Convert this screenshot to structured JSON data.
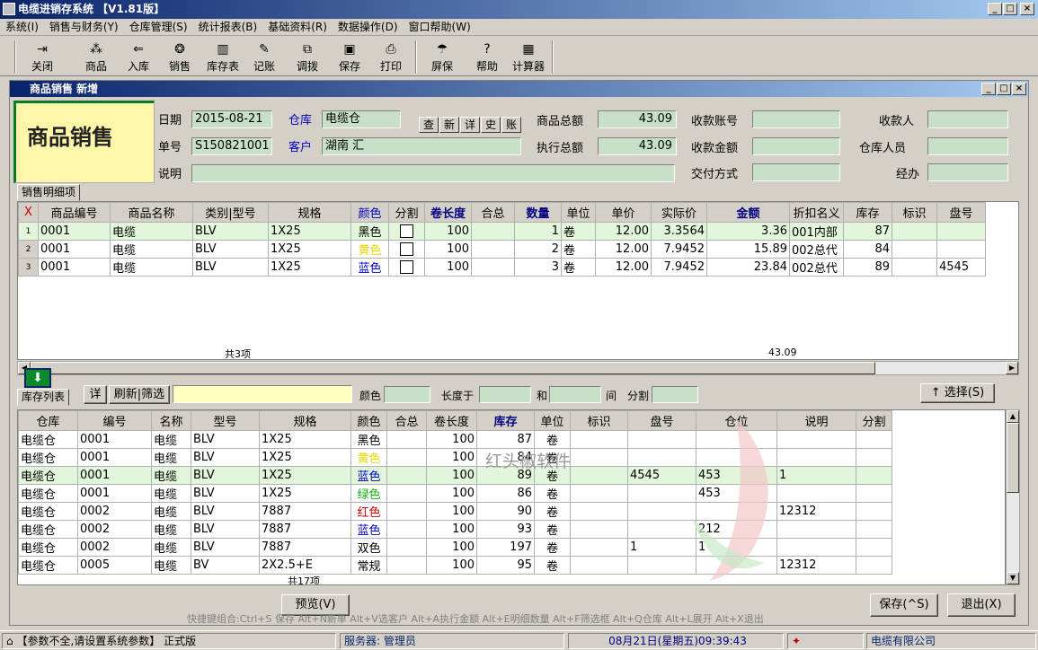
{
  "app": {
    "title": "电缆进销存系统 【V1.81版】"
  },
  "menu": [
    "系统(I)",
    "销售与财务(Y)",
    "仓库管理(S)",
    "统计报表(B)",
    "基础资料(R)",
    "数据操作(D)",
    "窗口帮助(W)"
  ],
  "toolbar": [
    {
      "label": "关闭",
      "icon": "exit-icon",
      "glyph": "⇥"
    },
    {
      "label": "商品",
      "icon": "goods-icon",
      "glyph": "⁂"
    },
    {
      "label": "入库",
      "icon": "stock-in-icon",
      "glyph": "⇐"
    },
    {
      "label": "销售",
      "icon": "sales-icon",
      "glyph": "❂"
    },
    {
      "label": "库存表",
      "icon": "inventory-chart-icon",
      "glyph": "▥"
    },
    {
      "label": "记账",
      "icon": "bookkeeping-icon",
      "glyph": "✎"
    },
    {
      "label": "调拨",
      "icon": "transfer-icon",
      "glyph": "⧉"
    },
    {
      "label": "保存",
      "icon": "save-icon",
      "glyph": "▣"
    },
    {
      "label": "打印",
      "icon": "print-icon",
      "glyph": "⎙"
    },
    {
      "label": "屏保",
      "icon": "screensaver-icon",
      "glyph": "☂"
    },
    {
      "label": "帮助",
      "icon": "help-icon",
      "glyph": "?"
    },
    {
      "label": "计算器",
      "icon": "calculator-icon",
      "glyph": "▦"
    }
  ],
  "form": {
    "window_title": "商品销售 新增",
    "logo_text": "商品销售",
    "date_label": "日期",
    "date_value": "2015-08-21",
    "warehouse_label": "仓库",
    "warehouse_value": "电缆仓",
    "order_label": "单号",
    "order_value": "S150821001",
    "customer_label": "客户",
    "customer_value": "湖南          汇",
    "note_label": "说明",
    "note_value": "",
    "mini_buttons": [
      "查",
      "新",
      "详",
      "史",
      "账"
    ],
    "goods_total_label": "商品总额",
    "goods_total_value": "43.09",
    "exec_total_label": "执行总额",
    "exec_total_value": "43.09",
    "account_label": "收款账号",
    "account_value": "",
    "amount_label": "收款金额",
    "amount_value": "",
    "pay_label": "交付方式",
    "pay_value": "",
    "receiver_label": "收款人",
    "receiver_value": "",
    "warehouse_staff_label": "仓库人员",
    "warehouse_staff_value": "",
    "handler_label": "经办",
    "handler_value": ""
  },
  "detail": {
    "tab": "销售明细项",
    "headers": [
      "X",
      "商品编号",
      "商品名称",
      "类别|型号",
      "规格",
      "颜色",
      "分割",
      "卷长度",
      "合总",
      "数量",
      "单位",
      "单价",
      "实际价",
      "金额",
      "折扣名义",
      "库存",
      "标识",
      "盘号"
    ],
    "rows": [
      {
        "n": "1",
        "code": "0001",
        "name": "电缆",
        "model": "BLV",
        "spec": "1X25",
        "color": "黑色",
        "colorHex": "#000000",
        "len": "100",
        "total": "",
        "qty": "1",
        "unit": "卷",
        "price": "12.00",
        "real": "3.3564",
        "amount": "3.36",
        "disc": "001内部",
        "stock": "87",
        "mark": "",
        "reel": ""
      },
      {
        "n": "2",
        "code": "0001",
        "name": "电缆",
        "model": "BLV",
        "spec": "1X25",
        "color": "黄色",
        "colorHex": "#e8d800",
        "len": "100",
        "total": "",
        "qty": "2",
        "unit": "卷",
        "price": "12.00",
        "real": "7.9452",
        "amount": "15.89",
        "disc": "002总代",
        "stock": "84",
        "mark": "",
        "reel": ""
      },
      {
        "n": "3",
        "code": "0001",
        "name": "电缆",
        "model": "BLV",
        "spec": "1X25",
        "color": "蓝色",
        "colorHex": "#0000c0",
        "len": "100",
        "total": "",
        "qty": "3",
        "unit": "卷",
        "price": "12.00",
        "real": "7.9452",
        "amount": "23.84",
        "disc": "002总代",
        "stock": "89",
        "mark": "",
        "reel": "4545"
      }
    ],
    "footer_count": "共3项",
    "footer_total": "43.09"
  },
  "stock": {
    "tab": "库存列表",
    "btn_detail": "详",
    "btn_refresh": "刷新|筛选",
    "color_label": "颜色",
    "length_label": "长度于",
    "and_label": "和",
    "between_label": "间",
    "split_label": "分割",
    "select_button": "↑ 选择(S)",
    "headers": [
      "仓库",
      "编号",
      "名称",
      "型号",
      "规格",
      "颜色",
      "合总",
      "卷长度",
      "库存",
      "单位",
      "标识",
      "盘号",
      "仓位",
      "说明",
      "分割"
    ],
    "rows": [
      {
        "wh": "电缆仓",
        "code": "0001",
        "name": "电缆",
        "model": "BLV",
        "spec": "1X25",
        "color": "黑色",
        "colorHex": "#000000",
        "total": "",
        "len": "100",
        "stock": "87",
        "unit": "卷",
        "mark": "",
        "reel": "",
        "loc": "",
        "note": ""
      },
      {
        "wh": "电缆仓",
        "code": "0001",
        "name": "电缆",
        "model": "BLV",
        "spec": "1X25",
        "color": "黄色",
        "colorHex": "#e8d800",
        "total": "",
        "len": "100",
        "stock": "84",
        "unit": "卷",
        "mark": "",
        "reel": "",
        "loc": "",
        "note": ""
      },
      {
        "wh": "电缆仓",
        "code": "0001",
        "name": "电缆",
        "model": "BLV",
        "spec": "1X25",
        "color": "蓝色",
        "colorHex": "#0000c0",
        "total": "",
        "len": "100",
        "stock": "89",
        "unit": "卷",
        "mark": "",
        "reel": "4545",
        "loc": "453",
        "note": "1"
      },
      {
        "wh": "电缆仓",
        "code": "0001",
        "name": "电缆",
        "model": "BLV",
        "spec": "1X25",
        "color": "绿色",
        "colorHex": "#10b010",
        "total": "",
        "len": "100",
        "stock": "86",
        "unit": "卷",
        "mark": "",
        "reel": "",
        "loc": "453",
        "note": ""
      },
      {
        "wh": "电缆仓",
        "code": "0002",
        "name": "电缆",
        "model": "BLV",
        "spec": "7887",
        "color": "红色",
        "colorHex": "#d00000",
        "total": "",
        "len": "100",
        "stock": "90",
        "unit": "卷",
        "mark": "",
        "reel": "",
        "loc": "",
        "note": "12312"
      },
      {
        "wh": "电缆仓",
        "code": "0002",
        "name": "电缆",
        "model": "BLV",
        "spec": "7887",
        "color": "蓝色",
        "colorHex": "#0000c0",
        "total": "",
        "len": "100",
        "stock": "93",
        "unit": "卷",
        "mark": "",
        "reel": "",
        "loc": "212",
        "note": ""
      },
      {
        "wh": "电缆仓",
        "code": "0002",
        "name": "电缆",
        "model": "BLV",
        "spec": "7887",
        "color": "双色",
        "colorHex": "#000000",
        "total": "",
        "len": "100",
        "stock": "197",
        "unit": "卷",
        "mark": "",
        "reel": "1",
        "loc": "1",
        "note": ""
      },
      {
        "wh": "电缆仓",
        "code": "0005",
        "name": "电缆",
        "model": "BV",
        "spec": "2X2.5+E",
        "color": "常规",
        "colorHex": "#000000",
        "total": "",
        "len": "100",
        "stock": "95",
        "unit": "卷",
        "mark": "",
        "reel": "",
        "loc": "",
        "note": "12312"
      }
    ],
    "footer_count": "共17项",
    "watermark": "红头椒软件"
  },
  "actions": {
    "preview": "预览(V)",
    "save": "保存(^S)",
    "exit": "退出(X)"
  },
  "hint": "快捷键组合:Ctrl+S 保存 Alt+N新单 Alt+V选客户 Alt+A执行金额 Alt+E明细数量 Alt+F筛选框 Alt+Q仓库 Alt+L展开 Alt+X退出",
  "status": {
    "params": "【参数不全,请设置系统参数】 正式版",
    "server": "服务器: 管理员",
    "datetime": "08月21日(星期五)09:39:43",
    "company": "电缆有限公司"
  }
}
